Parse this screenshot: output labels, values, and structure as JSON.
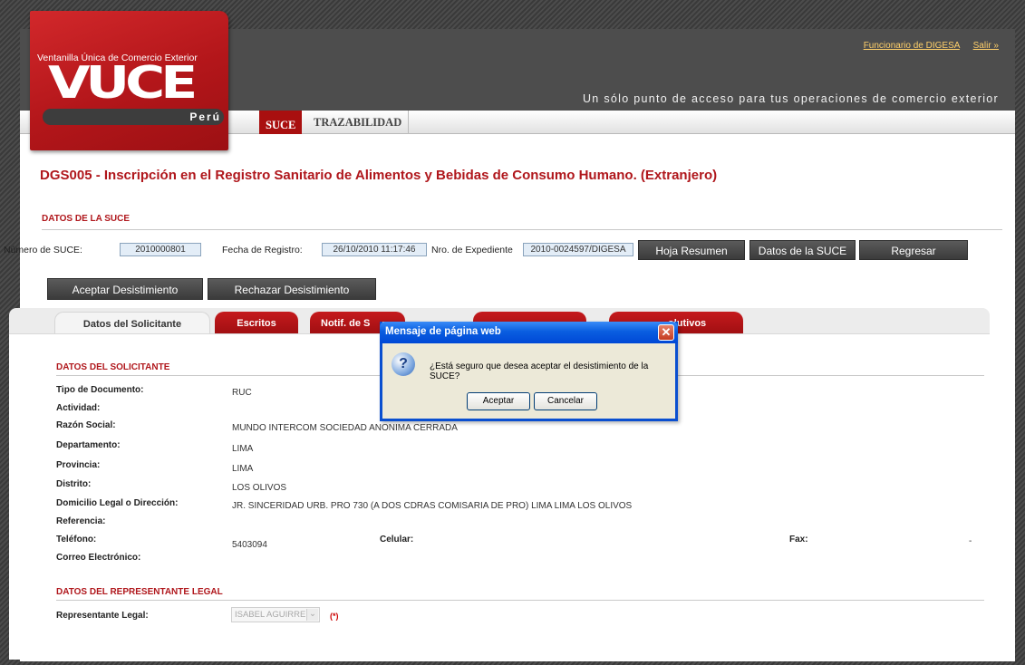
{
  "header": {
    "links": [
      "Funcionario de DIGESA",
      "Salir »"
    ],
    "tagline": "Un sólo punto de acceso para tus operaciones de comercio exterior"
  },
  "logo": {
    "subtitle": "Ventanilla Única de Comercio Exterior",
    "text": "VUCE",
    "country": "Perú"
  },
  "nav": {
    "tabs": [
      "SUCE",
      "TRAZABILIDAD"
    ],
    "active": "SUCE"
  },
  "page_title": "DGS005 - Inscripción en el Registro Sanitario de Alimentos y Bebidas de Consumo Humano. (Extranjero)",
  "datos_suce": {
    "section_title": "DATOS DE LA SUCE",
    "numero_label": "Número de SUCE:",
    "numero_value": "2010000801",
    "fecha_label": "Fecha de Registro:",
    "fecha_value": "26/10/2010 11:17:46",
    "expediente_label": "Nro. de Expediente",
    "expediente_value": "2010-0024597/DIGESA",
    "buttons": [
      "Hoja Resumen",
      "Datos de la SUCE",
      "Regresar"
    ]
  },
  "actions": [
    "Aceptar Desistimiento",
    "Rechazar Desistimiento"
  ],
  "tabs": [
    "Datos del Solicitante",
    "Escritos",
    "Notif. de S",
    "olutivos"
  ],
  "solicitante": {
    "section_title": "DATOS DEL SOLICITANTE",
    "rows": [
      {
        "label": "Tipo de Documento:",
        "value": "RUC"
      },
      {
        "label": "Actividad:",
        "value": ""
      },
      {
        "label": "Razón Social:",
        "value": "MUNDO INTERCOM SOCIEDAD ANONIMA CERRADA"
      },
      {
        "label": "Departamento:",
        "value": "LIMA"
      },
      {
        "label": "Provincia:",
        "value": "LIMA"
      },
      {
        "label": "Distrito:",
        "value": "LOS OLIVOS"
      },
      {
        "label": "Domicilio Legal o Dirección:",
        "value": "JR. SINCERIDAD URB. PRO 730 (A DOS CDRAS COMISARIA DE PRO) LIMA LIMA LOS OLIVOS"
      },
      {
        "label": "Referencia:",
        "value": ""
      },
      {
        "label": "Teléfono:",
        "value": "5403094"
      },
      {
        "label": "Correo Electrónico:",
        "value": ""
      }
    ],
    "celular_label": "Celular:",
    "fax_label": "Fax:",
    "fax_value": "-"
  },
  "representante": {
    "section_title": "DATOS DEL REPRESENTANTE LEGAL",
    "label": "Representante Legal:",
    "value": "ISABEL AGUIRRE",
    "required_mark": "(*)"
  },
  "dialog": {
    "title": "Mensaje de página web",
    "message": "¿Está seguro que desea aceptar el desistimiento de la SUCE?",
    "ok_label": "Aceptar",
    "cancel_label": "Cancelar",
    "close_glyph": "✕",
    "icon_glyph": "?"
  }
}
